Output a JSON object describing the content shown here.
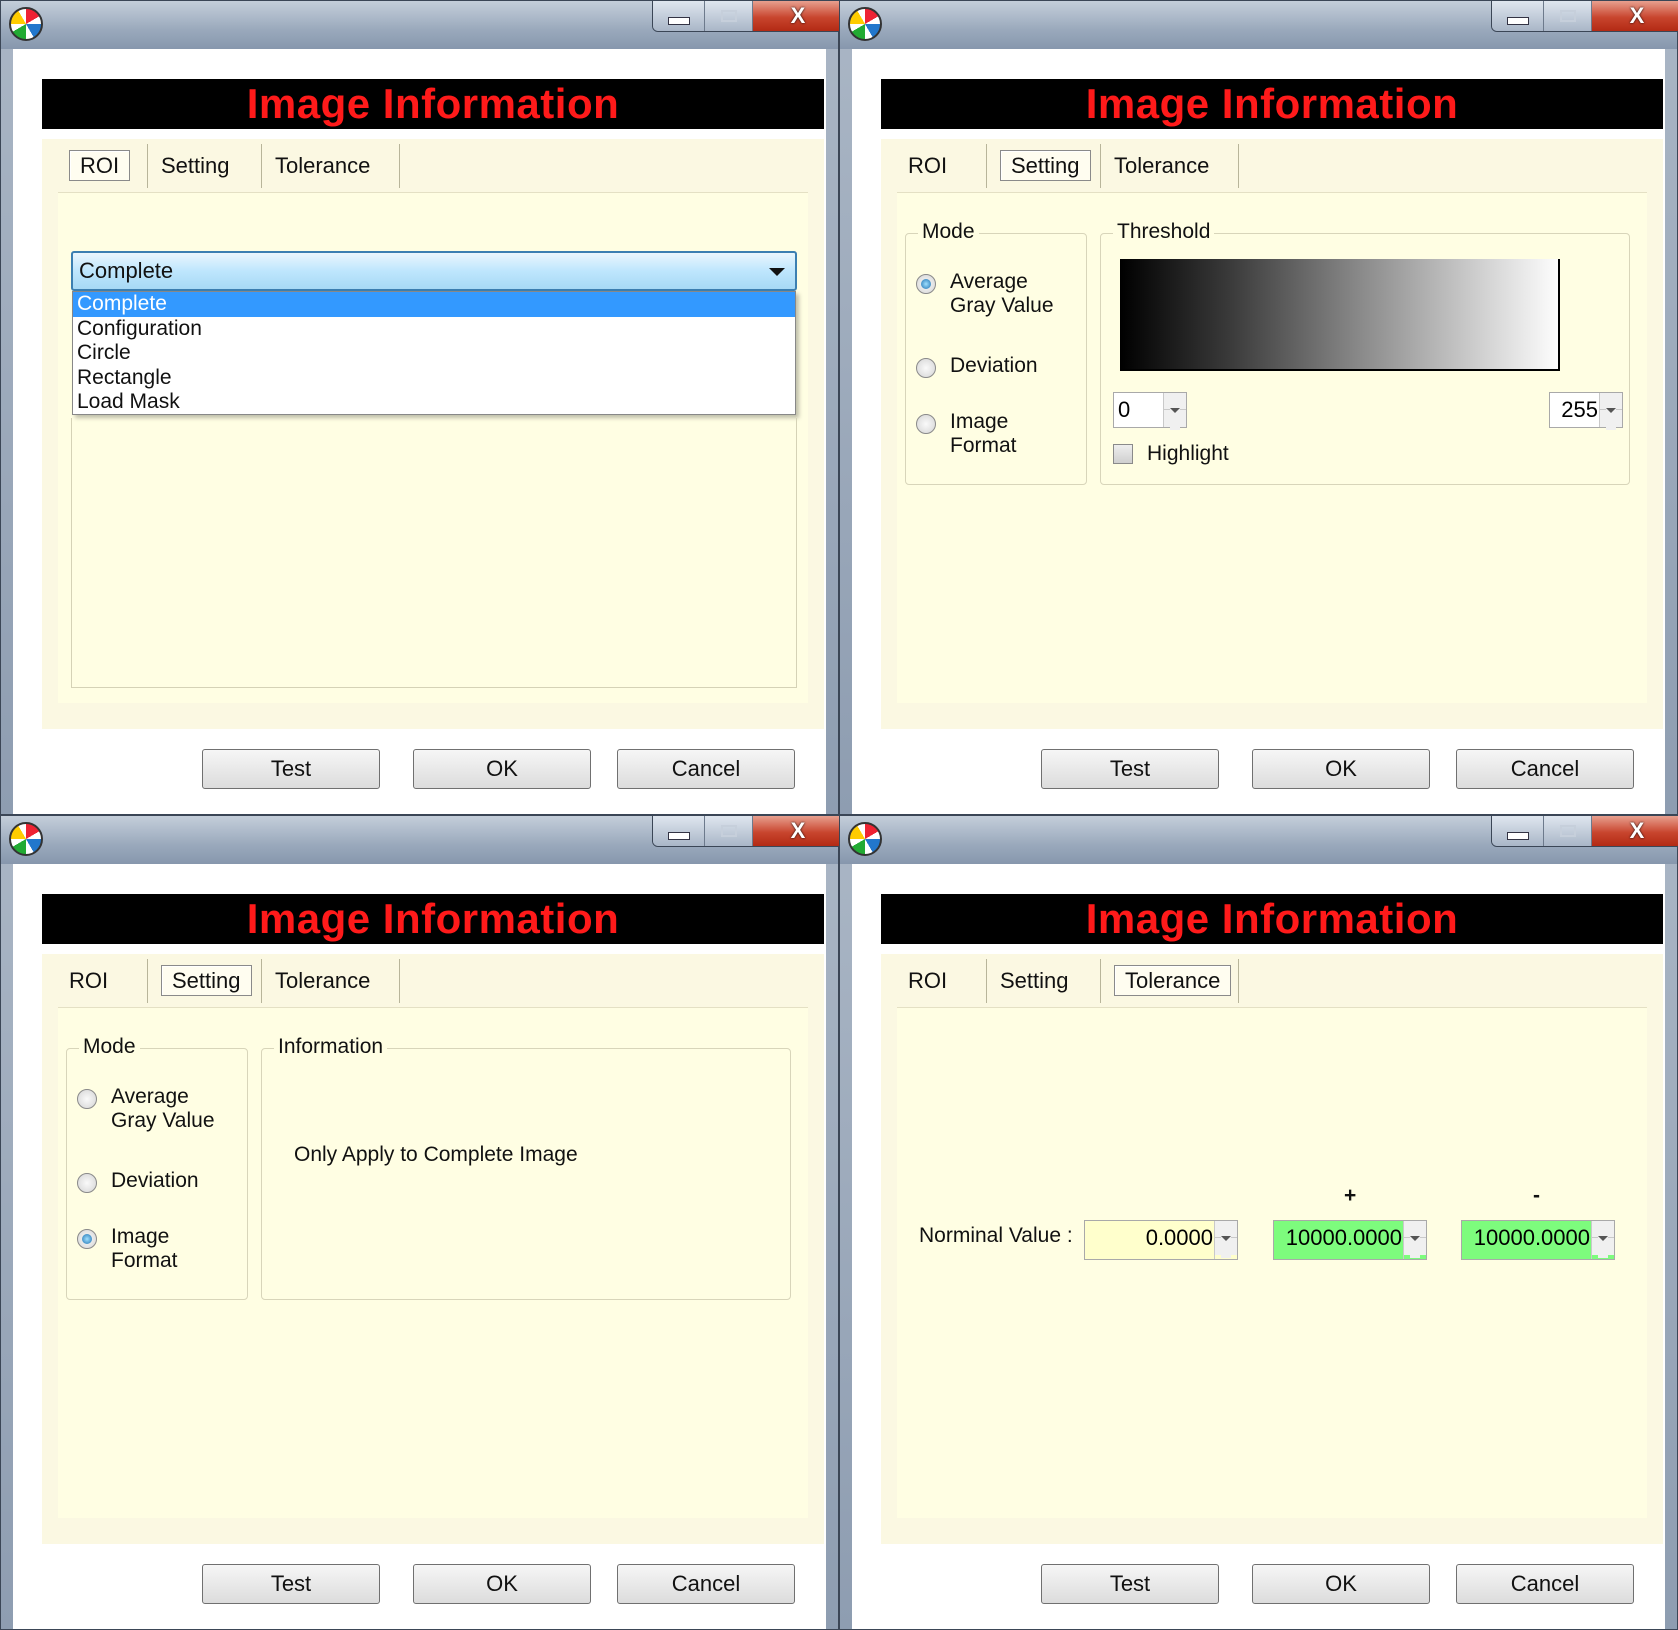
{
  "window_title": "Image Information",
  "tabs": [
    "ROI",
    "Setting",
    "Tolerance"
  ],
  "buttons": {
    "test": "Test",
    "ok": "OK",
    "cancel": "Cancel"
  },
  "icons": {
    "app": "app-logo-icon",
    "minimize": "minimize-icon",
    "maximize": "maximize-icon",
    "close": "close-icon",
    "close_glyph": "X"
  },
  "colors": {
    "banner_bg": "#000000",
    "banner_text": "#ff1a1a",
    "tab_bg": "#fffee3",
    "selection": "#3399ff",
    "tolerance_bg": "#7dfc7d",
    "nominal_bg": "#ffffcc"
  },
  "roi": {
    "combo_value": "Complete",
    "options": [
      "Complete",
      "Configuration",
      "Circle",
      "Rectangle",
      "Load Mask"
    ],
    "selected_index": 0
  },
  "setting_threshold": {
    "mode_legend": "Mode",
    "modes": [
      {
        "line1": "Average",
        "line2": "Gray Value",
        "selected": true
      },
      {
        "line1": "Deviation",
        "line2": "",
        "selected": false
      },
      {
        "line1": "Image",
        "line2": "Format",
        "selected": false
      }
    ],
    "threshold_legend": "Threshold",
    "min": "0",
    "max": "255",
    "highlight_label": "Highlight",
    "highlight_checked": false
  },
  "setting_info": {
    "mode_legend": "Mode",
    "modes": [
      {
        "line1": "Average",
        "line2": "Gray Value",
        "selected": false
      },
      {
        "line1": "Deviation",
        "line2": "",
        "selected": false
      },
      {
        "line1": "Image",
        "line2": "Format",
        "selected": true
      }
    ],
    "info_legend": "Information",
    "info_text": "Only Apply to Complete Image"
  },
  "tolerance": {
    "nominal_label": "Norminal Value :",
    "nominal_value": "0.0000",
    "plus_label": "+",
    "plus_value": "10000.0000",
    "minus_label": "-",
    "minus_value": "10000.0000"
  }
}
